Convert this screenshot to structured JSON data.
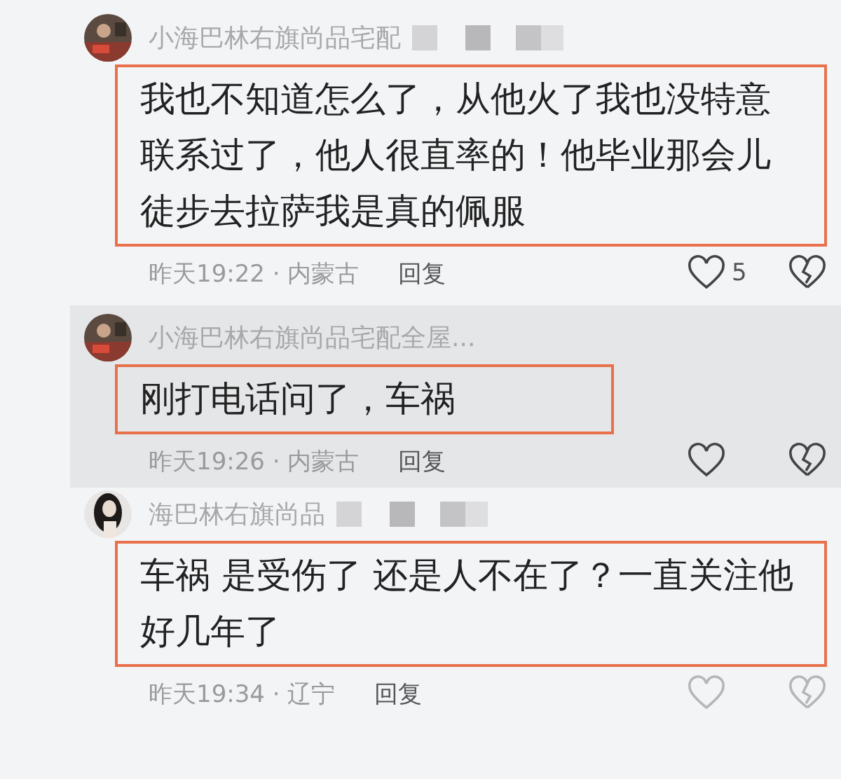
{
  "comments": [
    {
      "name": "小海巴林右旗尚品宅配",
      "highlighted": false,
      "body": "我也不知道怎么了，从他火了我也没特意联系过了，他人很直率的！他毕业那会儿徒步去拉萨我是真的佩服",
      "time": "昨天19:22 · 内蒙古",
      "reply": "回复",
      "likes": "5"
    },
    {
      "name": "小海巴林右旗尚品宅配全屋...",
      "highlighted": true,
      "body": "刚打电话问了，车祸",
      "time": "昨天19:26 · 内蒙古",
      "reply": "回复"
    },
    {
      "name": "海巴林右旗尚品",
      "highlighted": false,
      "body": "车祸 是受伤了 还是人不在了？一直关注他好几年了",
      "time": "昨天19:34 · 辽宁",
      "reply": "回复"
    }
  ]
}
